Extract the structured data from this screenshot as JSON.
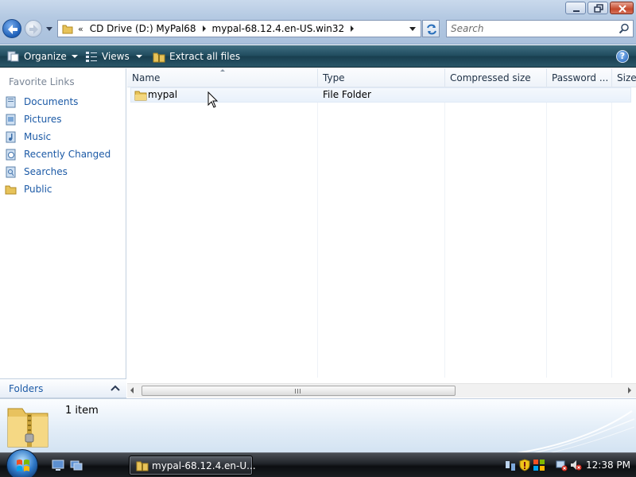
{
  "window": {
    "controls": {
      "minimize": "minimize",
      "maximize": "maximize",
      "close": "close"
    }
  },
  "address": {
    "chevron": "«",
    "breadcrumbs": [
      "CD Drive (D:) MyPal68",
      "mypal-68.12.4.en-US.win32"
    ]
  },
  "search": {
    "placeholder": "Search"
  },
  "command_bar": {
    "organize": "Organize",
    "views": "Views",
    "extract": "Extract all files",
    "help": "?"
  },
  "nav_pane": {
    "heading": "Favorite Links",
    "links": [
      {
        "label": "Documents",
        "icon": "documents-icon"
      },
      {
        "label": "Pictures",
        "icon": "pictures-icon"
      },
      {
        "label": "Music",
        "icon": "music-icon"
      },
      {
        "label": "Recently Changed",
        "icon": "recently-changed-icon"
      },
      {
        "label": "Searches",
        "icon": "searches-icon"
      },
      {
        "label": "Public",
        "icon": "public-folder-icon"
      }
    ],
    "folders_label": "Folders"
  },
  "file_list": {
    "columns": [
      "Name",
      "Type",
      "Compressed size",
      "Password ...",
      "Size"
    ],
    "rows": [
      {
        "name": "mypal",
        "type": "File Folder",
        "compressed_size": "",
        "password": "",
        "size": ""
      }
    ]
  },
  "details": {
    "count": "1 item"
  },
  "taskbar": {
    "active_window": "mypal-68.12.4.en-U...",
    "clock": "12:38 PM"
  },
  "colors": {
    "link_blue": "#1c5aa6",
    "command_bar": "#1f4a5d",
    "title_bar": "#b4c9e2"
  }
}
